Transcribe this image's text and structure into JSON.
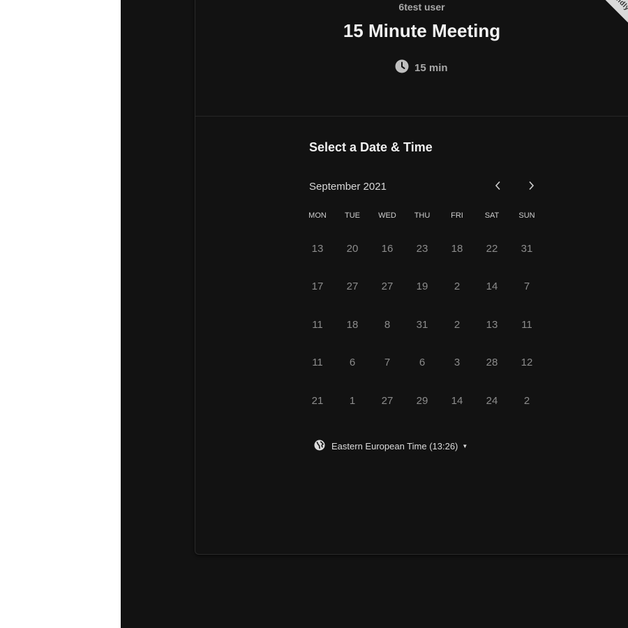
{
  "header": {
    "host_name": "6test user",
    "event_title": "15 Minute Meeting",
    "duration": "15 min",
    "ribbon": "Calendly"
  },
  "calendar": {
    "section_title": "Select a Date & Time",
    "month_label": "September 2021",
    "weekdays": [
      "MON",
      "TUE",
      "WED",
      "THU",
      "FRI",
      "SAT",
      "SUN"
    ],
    "days": [
      "13",
      "20",
      "16",
      "23",
      "18",
      "22",
      "31",
      "17",
      "27",
      "27",
      "19",
      "2",
      "14",
      "7",
      "11",
      "18",
      "8",
      "31",
      "2",
      "13",
      "11",
      "11",
      "6",
      "7",
      "6",
      "3",
      "28",
      "12",
      "21",
      "1",
      "27",
      "29",
      "14",
      "24",
      "2"
    ]
  },
  "timezone": {
    "label": "Eastern European Time (13:26)"
  },
  "icons": {
    "duration": "clock-icon",
    "timezone": "globe-icon",
    "prev": "chevron-left-icon",
    "next": "chevron-right-icon"
  },
  "colors": {
    "background": "#121212",
    "text_primary": "#f2f2f2",
    "text_muted": "#8c8c8c"
  }
}
